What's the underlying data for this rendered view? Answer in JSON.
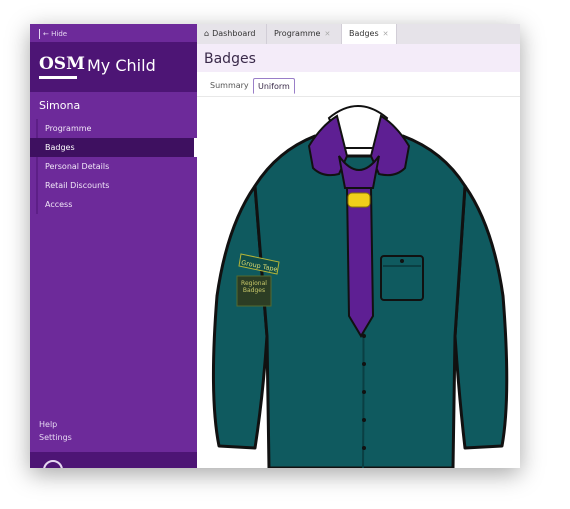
{
  "sidebar": {
    "hide_label": "Hide",
    "logo_text": "OSM",
    "brand_name": "My Child",
    "child_name": "Simona",
    "items": [
      {
        "label": "Programme"
      },
      {
        "label": "Badges"
      },
      {
        "label": "Personal Details"
      },
      {
        "label": "Retail Discounts"
      },
      {
        "label": "Access"
      }
    ],
    "active_item": "Badges",
    "footer": {
      "help": "Help",
      "settings": "Settings"
    }
  },
  "tabs": [
    {
      "label": "Dashboard",
      "icon": "home-icon",
      "closable": false
    },
    {
      "label": "Programme",
      "closable": true
    },
    {
      "label": "Badges",
      "closable": true
    }
  ],
  "active_tab": "Badges",
  "page": {
    "title": "Badges",
    "subtabs": [
      {
        "label": "Summary"
      },
      {
        "label": "Uniform"
      }
    ],
    "active_subtab": "Uniform"
  },
  "uniform": {
    "patches": [
      {
        "label": "Group Tape"
      },
      {
        "label": "Regional Badges"
      }
    ],
    "colors": {
      "shirt": "#0f5a5f",
      "scarf": "#5e1f93",
      "woggle": "#f1cf1b",
      "outline": "#111111"
    }
  },
  "colors": {
    "sidebar": "#6d2a9a",
    "sidebar_dark": "#4d1575",
    "active_nav": "#3e1060"
  }
}
